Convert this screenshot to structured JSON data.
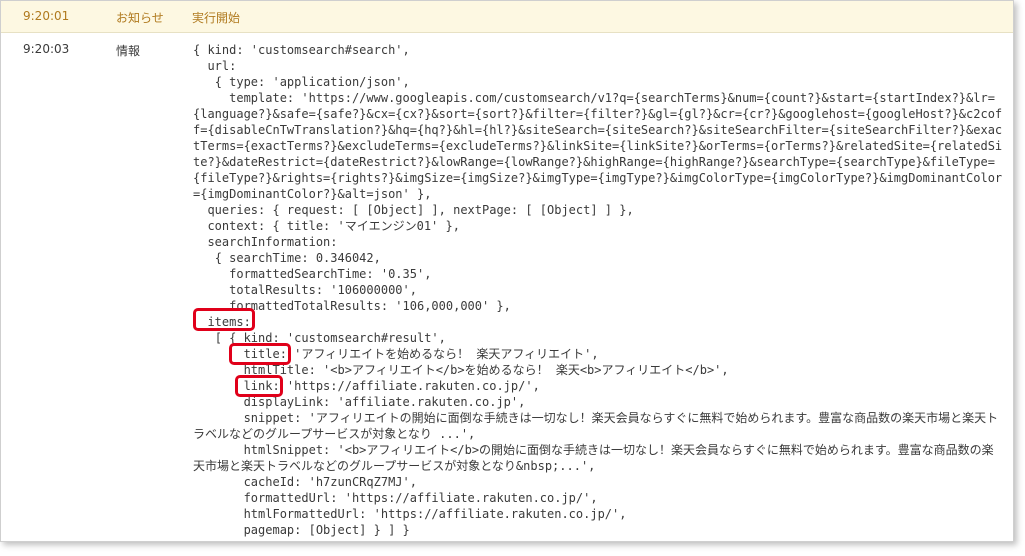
{
  "log": {
    "header": {
      "time": "9:20:01",
      "level": "お知らせ",
      "message": "実行開始"
    },
    "entry": {
      "time": "9:20:03",
      "level": "情報",
      "body": "{ kind: 'customsearch#search',\n  url:\n   { type: 'application/json',\n     template: 'https://www.googleapis.com/customsearch/v1?q={searchTerms}&num={count?}&start={startIndex?}&lr={language?}&safe={safe?}&cx={cx?}&sort={sort?}&filter={filter?}&gl={gl?}&cr={cr?}&googlehost={googleHost?}&c2coff={disableCnTwTranslation?}&hq={hq?}&hl={hl?}&siteSearch={siteSearch?}&siteSearchFilter={siteSearchFilter?}&exactTerms={exactTerms?}&excludeTerms={excludeTerms?}&linkSite={linkSite?}&orTerms={orTerms?}&relatedSite={relatedSite?}&dateRestrict={dateRestrict?}&lowRange={lowRange?}&highRange={highRange?}&searchType={searchType}&fileType={fileType?}&rights={rights?}&imgSize={imgSize?}&imgType={imgType?}&imgColorType={imgColorType?}&imgDominantColor={imgDominantColor?}&alt=json' },\n  queries: { request: [ [Object] ], nextPage: [ [Object] ] },\n  context: { title: 'マイエンジン01' },\n  searchInformation:\n   { searchTime: 0.346042,\n     formattedSearchTime: '0.35',\n     totalResults: '106000000',\n     formattedTotalResults: '106,000,000' },\n  items:\n   [ { kind: 'customsearch#result',\n       title: 'アフィリエイトを始めるなら！ 楽天アフィリエイト',\n       htmlTitle: '<b>アフィリエイト</b>を始めるなら！ 楽天<b>アフィリエイト</b>',\n       link: 'https://affiliate.rakuten.co.jp/',\n       displayLink: 'affiliate.rakuten.co.jp',\n       snippet: 'アフィリエイトの開始に面倒な手続きは一切なし！楽天会員ならすぐに無料で始められます。豊富な商品数の楽天市場と楽天トラベルなどのグループサービスが対象となり ...',\n       htmlSnippet: '<b>アフィリエイト</b>の開始に面倒な手続きは一切なし！楽天会員ならすぐに無料で始められます。豊富な商品数の楽天市場と楽天トラベルなどのグループサービスが対象となり&nbsp;...',\n       cacheId: 'h7zunCRqZ7MJ',\n       formattedUrl: 'https://affiliate.rakuten.co.jp/',\n       htmlFormattedUrl: 'https://affiliate.rakuten.co.jp/',\n       pagemap: [Object] } ] }"
    }
  },
  "highlight_color": "#e0001a"
}
